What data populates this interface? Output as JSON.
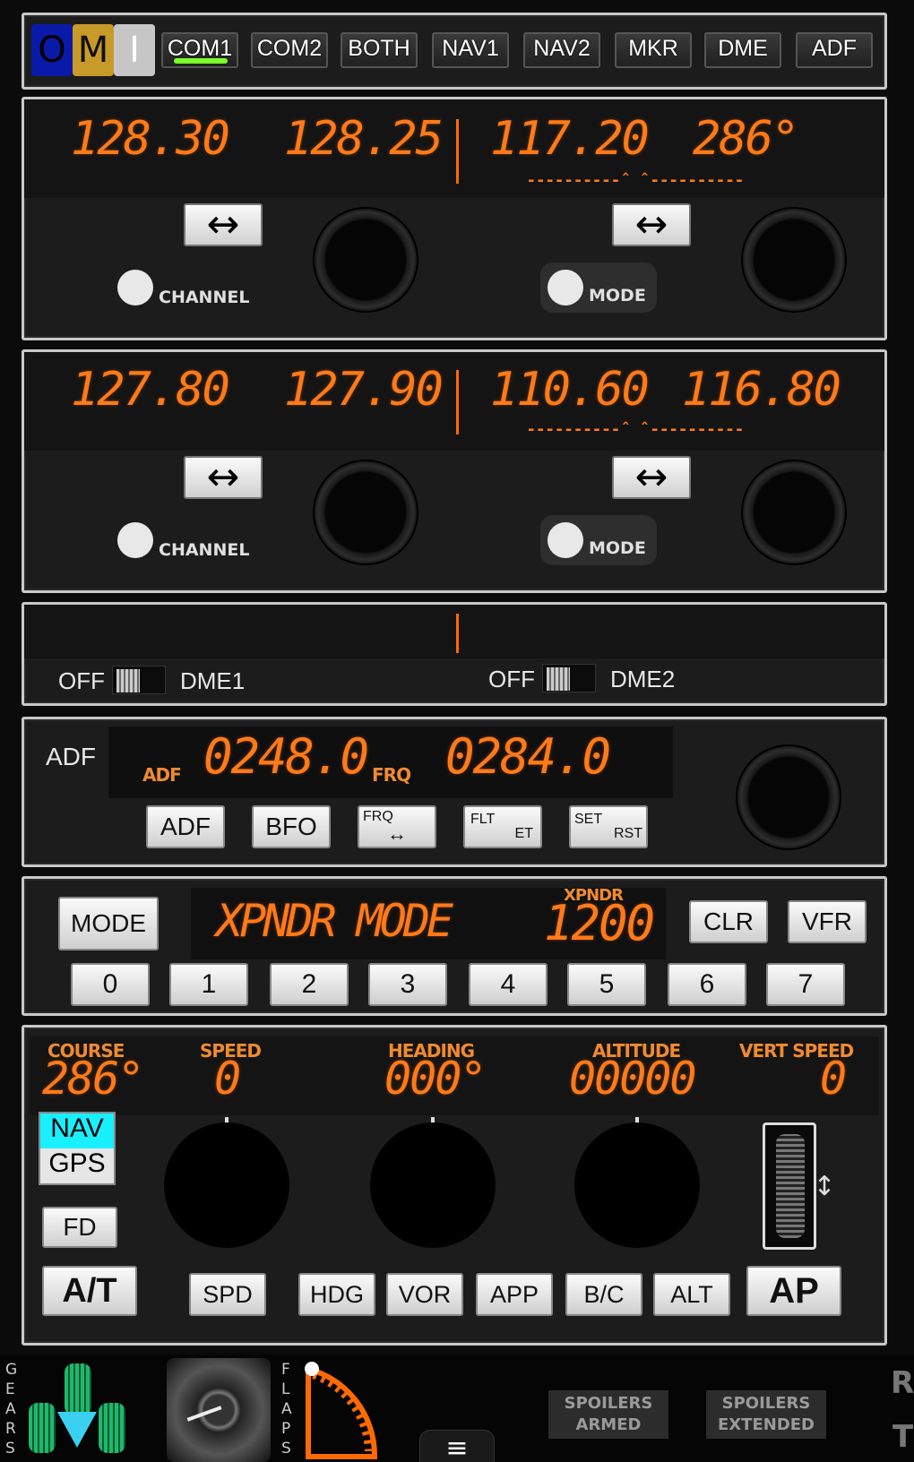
{
  "top": {
    "omi": {
      "o": "O",
      "m": "M",
      "i": "I"
    },
    "tabs": [
      "COM1",
      "COM2",
      "BOTH",
      "NAV1",
      "NAV2",
      "MKR",
      "DME",
      "ADF"
    ]
  },
  "radio1": {
    "com_active": "128.30",
    "com_standby": "128.25",
    "nav_active": "117.20",
    "nav_right": "286°",
    "channel_label": "CHANNEL",
    "mode_label": "MODE"
  },
  "radio2": {
    "com_active": "127.80",
    "com_standby": "127.90",
    "nav_active": "110.60",
    "nav_right": "116.80",
    "channel_label": "CHANNEL",
    "mode_label": "MODE"
  },
  "dme": {
    "off1": "OFF",
    "dme1": "DME1",
    "off2": "OFF",
    "dme2": "DME2"
  },
  "adf": {
    "title": "ADF",
    "adf_label": "ADF",
    "adf_value": "0248.0",
    "frq_label": "FRQ",
    "frq_value": "0284.0",
    "buttons": [
      "ADF",
      "BFO"
    ],
    "frq_btn": {
      "sup": "FRQ",
      "sub": "↔"
    },
    "flt_btn": {
      "sup": "FLT",
      "sub": "ET"
    },
    "set_btn": {
      "sup": "SET",
      "sub": "RST"
    }
  },
  "xpndr": {
    "mode_btn": "MODE",
    "display": "XPNDR MODE",
    "code_label": "XPNDR",
    "code": "1200",
    "clr": "CLR",
    "vfr": "VFR",
    "digits": [
      "0",
      "1",
      "2",
      "3",
      "4",
      "5",
      "6",
      "7"
    ]
  },
  "autopilot": {
    "course_label": "COURSE",
    "course": "286°",
    "speed_label": "SPEED",
    "speed": "0",
    "heading_label": "HEADING",
    "heading": "000°",
    "altitude_label": "ALTITUDE",
    "altitude": "00000",
    "vs_label": "VERT SPEED",
    "vs": "0",
    "nav": "NAV",
    "gps": "GPS",
    "fd": "FD",
    "at": "A/T",
    "ap": "AP",
    "modes": [
      "SPD",
      "HDG",
      "VOR",
      "APP",
      "B/C",
      "ALT"
    ]
  },
  "bottom": {
    "gears": "GEARS",
    "flaps": "FLAPS",
    "spoilers_armed": [
      "SPOILERS",
      "ARMED"
    ],
    "spoilers_extended": [
      "SPOILERS",
      "EXTENDED"
    ],
    "menu": "≡",
    "edge": [
      "R",
      "T"
    ]
  },
  "colors": {
    "segment": "#ff7a18",
    "nav_highlight": "#19f0ff",
    "gear_green": "#1fb86a",
    "arrow_cyan": "#3ad0f0",
    "omi_o": "#0a1aa8",
    "omi_m": "#c79a2a",
    "omi_i": "#c6c6c6"
  }
}
